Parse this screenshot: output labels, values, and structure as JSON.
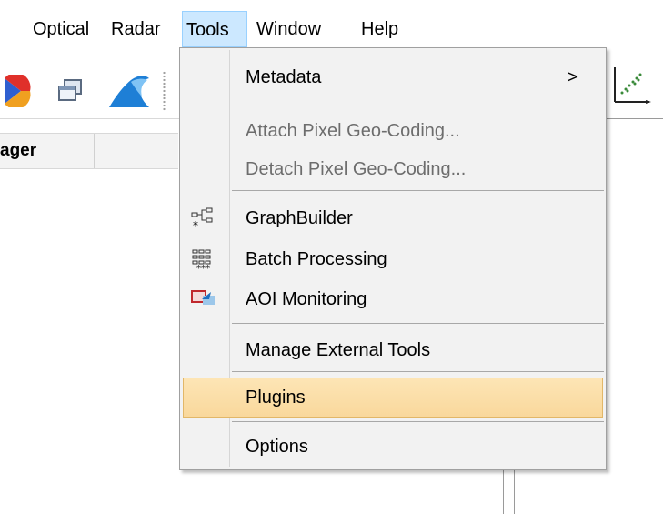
{
  "menubar": {
    "items": [
      {
        "label": "Optical"
      },
      {
        "label": "Radar"
      },
      {
        "label": "Tools"
      },
      {
        "label": "Window"
      },
      {
        "label": "Help"
      }
    ]
  },
  "panel": {
    "header_partial": "ager"
  },
  "tools_menu": {
    "items": [
      {
        "label": "Metadata",
        "submenu_arrow": ">"
      },
      {
        "label": "Attach Pixel Geo-Coding..."
      },
      {
        "label": "Detach Pixel Geo-Coding..."
      },
      {
        "label": "GraphBuilder"
      },
      {
        "label": "Batch Processing"
      },
      {
        "label": "AOI Monitoring"
      },
      {
        "label": "Manage External Tools"
      },
      {
        "label": "Plugins"
      },
      {
        "label": "Options"
      }
    ]
  },
  "colors": {
    "menu_bg": "#f2f2f2",
    "highlight": "#fbdca3",
    "active_menubar": "#cce8ff",
    "disabled_text": "#6d6d6d"
  },
  "icons": [
    "colorwheel-icon",
    "windows-icon",
    "wave-icon",
    "scatter-plot-icon",
    "graph-builder-icon",
    "batch-processing-icon",
    "aoi-monitoring-icon"
  ]
}
